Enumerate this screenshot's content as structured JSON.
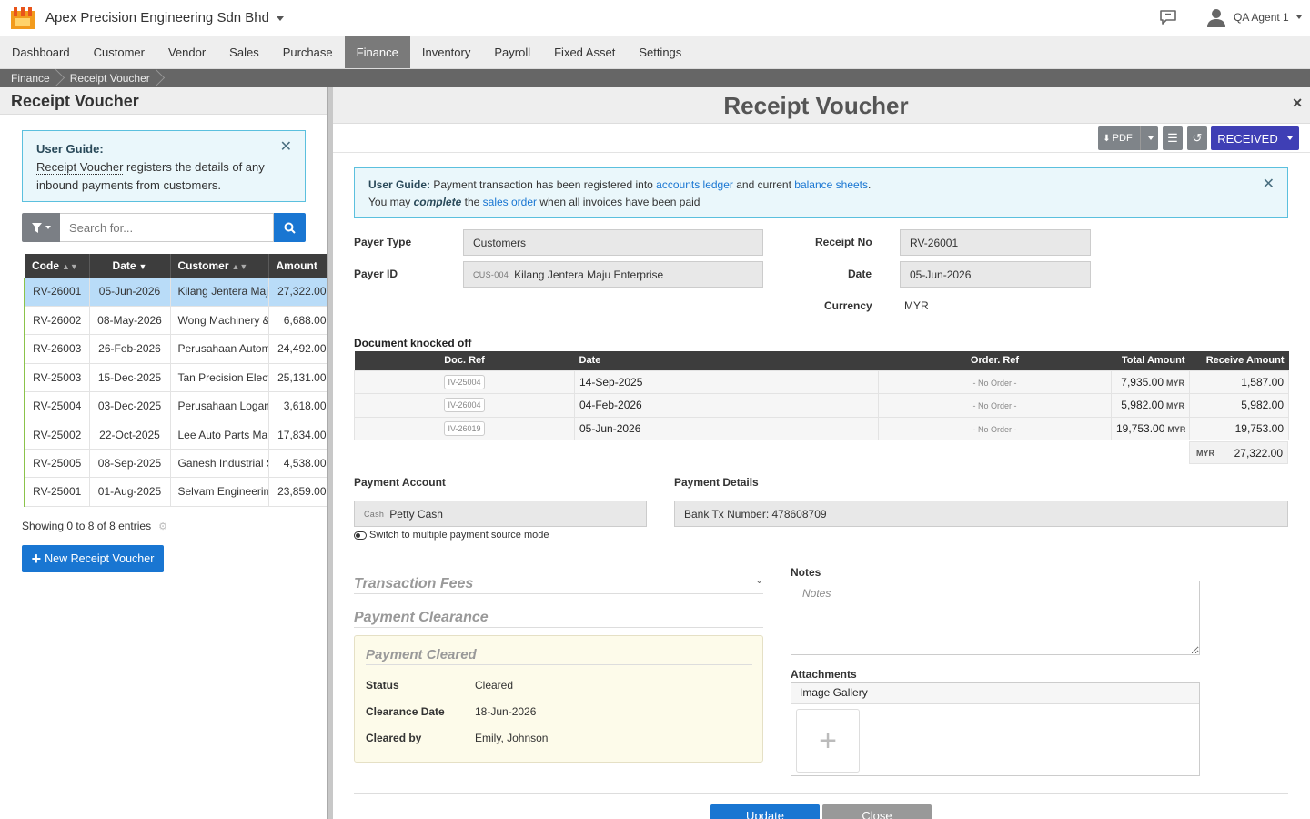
{
  "header": {
    "company": "Apex Precision Engineering Sdn Bhd",
    "user": "QA Agent 1"
  },
  "menu": {
    "items": [
      "Dashboard",
      "Customer",
      "Vendor",
      "Sales",
      "Purchase",
      "Finance",
      "Inventory",
      "Payroll",
      "Fixed Asset",
      "Settings"
    ],
    "active": "Finance"
  },
  "breadcrumb": [
    "Finance",
    "Receipt Voucher"
  ],
  "left": {
    "title": "Receipt Voucher",
    "guide": {
      "title": "User Guide:",
      "link": "Receipt Voucher",
      "text": " registers the details of any inbound payments from customers."
    },
    "search_placeholder": "Search for...",
    "columns": [
      "Code",
      "Date",
      "Customer",
      "Amount"
    ],
    "rows": [
      {
        "code": "RV-26001",
        "date": "05-Jun-2026",
        "customer": "Kilang Jentera Maju Enterprise",
        "amount": "27,322.00"
      },
      {
        "code": "RV-26002",
        "date": "08-May-2026",
        "customer": "Wong Machinery & Tools",
        "amount": "6,688.00"
      },
      {
        "code": "RV-26003",
        "date": "26-Feb-2026",
        "customer": "Perusahaan Automasi",
        "amount": "24,492.00"
      },
      {
        "code": "RV-25003",
        "date": "15-Dec-2025",
        "customer": "Tan Precision Electronics",
        "amount": "25,131.00"
      },
      {
        "code": "RV-25004",
        "date": "03-Dec-2025",
        "customer": "Perusahaan Logam",
        "amount": "3,618.00"
      },
      {
        "code": "RV-25002",
        "date": "22-Oct-2025",
        "customer": "Lee Auto Parts Manufacturing",
        "amount": "17,834.00"
      },
      {
        "code": "RV-25005",
        "date": "08-Sep-2025",
        "customer": "Ganesh Industrial Supplies",
        "amount": "4,538.00"
      },
      {
        "code": "RV-25001",
        "date": "01-Aug-2025",
        "customer": "Selvam Engineering Works",
        "amount": "23,859.00"
      }
    ],
    "selected_index": 0,
    "showing": "Showing 0 to 8 of 8 entries",
    "new_button": "New Receipt Voucher"
  },
  "detail": {
    "title": "Receipt Voucher",
    "toolbar": {
      "pdf": "PDF",
      "status": "RECEIVED"
    },
    "guide": {
      "title": "User Guide:",
      "line1_a": " Payment transaction has been registered into ",
      "link1": "accounts ledger",
      "line1_b": " and current ",
      "link2": "balance sheets",
      "line1_c": ".",
      "line2_a": "You may ",
      "emph": "complete",
      "line2_b": " the ",
      "link3": "sales order",
      "line2_c": " when all invoices have been paid"
    },
    "payer_type_label": "Payer Type",
    "payer_type": "Customers",
    "payer_id_label": "Payer ID",
    "payer_id_tag": "CUS-004",
    "payer_id": "Kilang Jentera Maju Enterprise",
    "receipt_no_label": "Receipt No",
    "receipt_no": "RV-26001",
    "date_label": "Date",
    "date": "05-Jun-2026",
    "currency_label": "Currency",
    "currency": "MYR",
    "docs_label": "Document knocked off",
    "doc_columns": [
      "Doc. Ref",
      "Date",
      "Order. Ref",
      "Total Amount",
      "Receive Amount"
    ],
    "docs": [
      {
        "ref": "IV-25004",
        "date": "14-Sep-2025",
        "order": "- No Order -",
        "total": "7,935.00",
        "receive": "1,587.00"
      },
      {
        "ref": "IV-26004",
        "date": "04-Feb-2026",
        "order": "- No Order -",
        "total": "5,982.00",
        "receive": "5,982.00"
      },
      {
        "ref": "IV-26019",
        "date": "05-Jun-2026",
        "order": "- No Order -",
        "total": "19,753.00",
        "receive": "19,753.00"
      }
    ],
    "currency_tag": "MYR",
    "total_receive": "27,322.00",
    "payment_account_label": "Payment Account",
    "payment_account_tag": "Cash",
    "payment_account": "Petty Cash",
    "switch_text": "Switch to multiple payment source mode",
    "payment_details_label": "Payment Details",
    "payment_details": "Bank Tx Number: 478608709",
    "transaction_fees": "Transaction Fees",
    "payment_clearance": "Payment Clearance",
    "cleared": {
      "title": "Payment Cleared",
      "status_label": "Status",
      "status": "Cleared",
      "date_label": "Clearance Date",
      "date": "18-Jun-2026",
      "by_label": "Cleared by",
      "by": "Emily, Johnson"
    },
    "notes_label": "Notes",
    "notes_placeholder": "Notes",
    "attachments_label": "Attachments",
    "gallery_label": "Image Gallery",
    "update_button": "Update",
    "close_button": "Close"
  },
  "colors": {
    "primary": "#1976d2",
    "status": "#3f3fb5",
    "selected_row": "#b9dcf8"
  }
}
